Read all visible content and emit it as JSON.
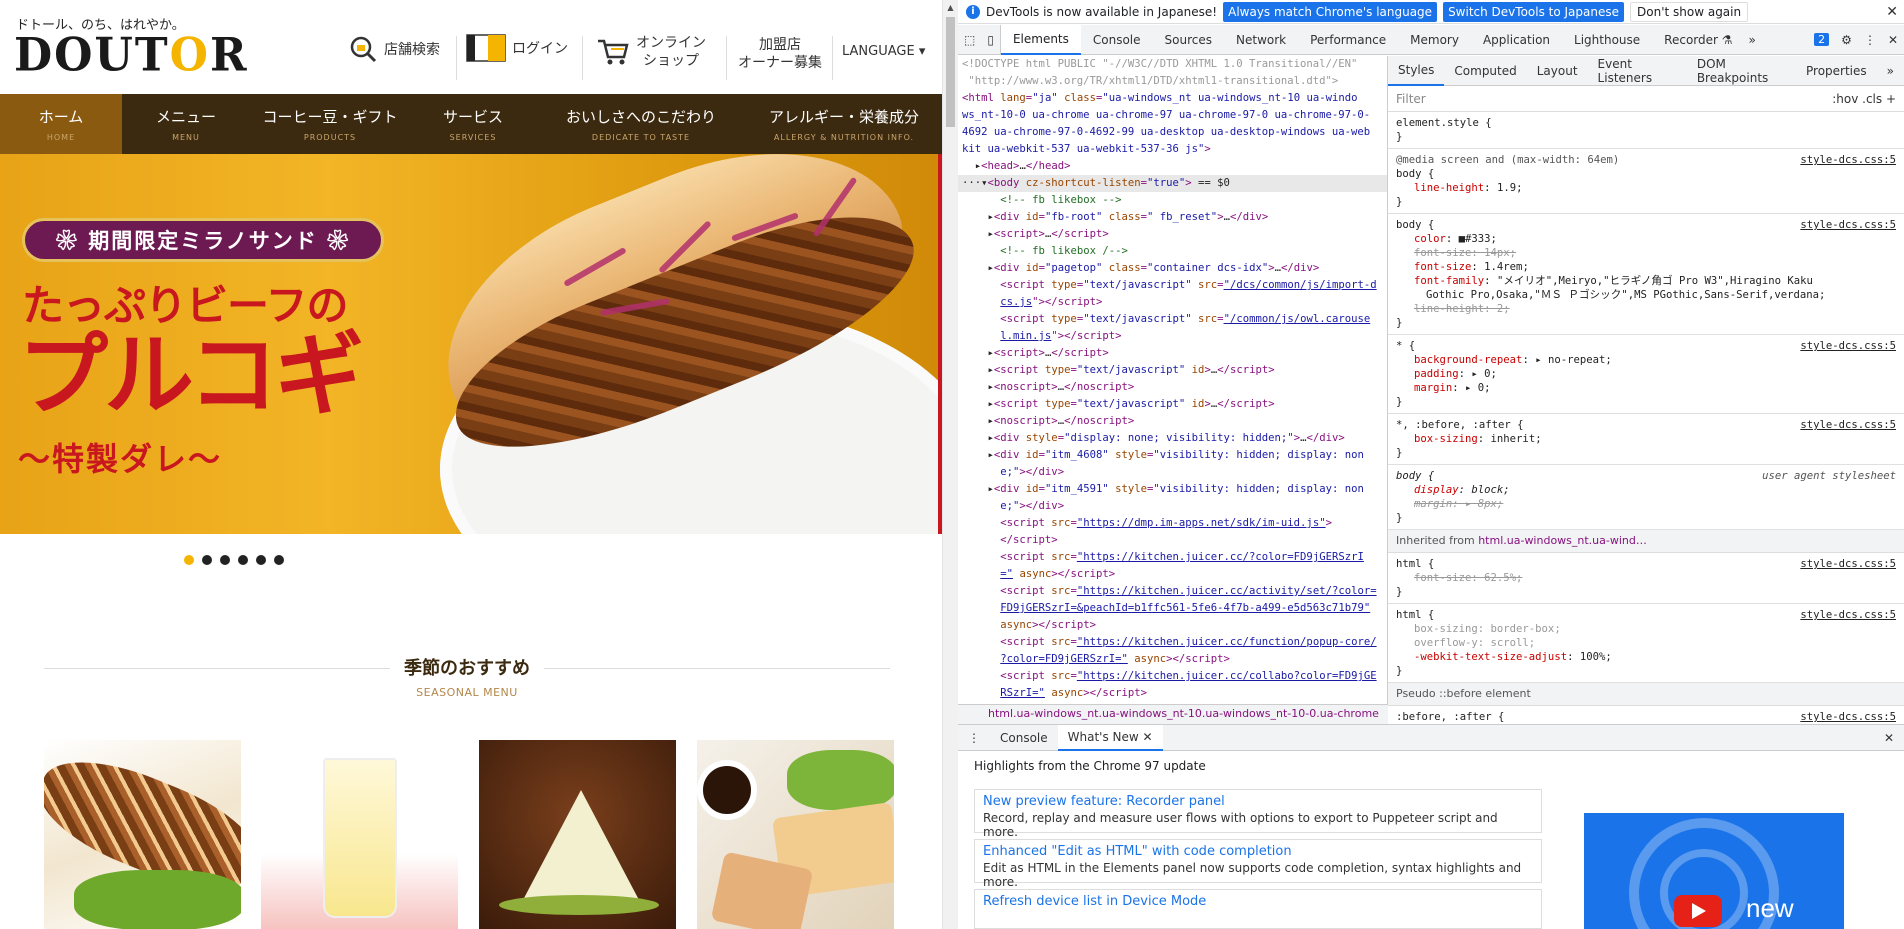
{
  "site": {
    "tagline": "ドトール、のち、はれやか。",
    "logo_text": "DOUTOR",
    "header_links": [
      {
        "label": "店舗検索",
        "icon": "store-search-icon"
      },
      {
        "label": "ログイン",
        "icon": "card-icon"
      },
      {
        "label": "オンライン\nショップ",
        "icon": "cart-icon"
      },
      {
        "label": "加盟店\nオーナー募集",
        "icon": ""
      },
      {
        "label": "LANGUAGE ▾",
        "icon": ""
      }
    ],
    "nav": [
      {
        "jp": "ホーム",
        "en": "HOME",
        "active": true
      },
      {
        "jp": "メニュー",
        "en": "MENU"
      },
      {
        "jp": "コーヒー豆・ギフト",
        "en": "PRODUCTS"
      },
      {
        "jp": "サービス",
        "en": "SERVICES"
      },
      {
        "jp": "おいしさへのこだわり",
        "en": "DEDICATE TO TASTE"
      },
      {
        "jp": "アレルギー・栄養成分",
        "en": "ALLERGY & NUTRITION INFO."
      }
    ],
    "hero": {
      "badge": "❀ 期間限定ミラノサンド ❀",
      "line1": "たっぷりビーフの",
      "line2": "プルコギ",
      "line3": "〜特製ダレ〜"
    },
    "carousel_dots": 6,
    "section": {
      "title": "季節のおすすめ",
      "subtitle": "SEASONAL MENU"
    },
    "colors": {
      "nav_bg": "#3c2a10",
      "nav_active": "#8a5a10",
      "accent": "#f5b400",
      "hero_red": "#c8171e"
    }
  },
  "devtools": {
    "infobar": {
      "message": "DevTools is now available in Japanese!",
      "btn1": "Always match Chrome's language",
      "btn2": "Switch DevTools to Japanese",
      "btn3": "Don't show again"
    },
    "tabs": [
      "Elements",
      "Console",
      "Sources",
      "Network",
      "Performance",
      "Memory",
      "Application",
      "Lighthouse",
      "Recorder ⚗"
    ],
    "issues_badge": "2",
    "style_tabs": [
      "Styles",
      "Computed",
      "Layout",
      "Event Listeners",
      "DOM Breakpoints",
      "Properties"
    ],
    "filter_placeholder": "Filter",
    "filter_opts": ":hov  .cls  +",
    "breadcrumb": "html.ua-windows_nt.ua-windows_nt-10.ua-windows_nt-10-0.ua-chrome",
    "drawer_tabs": [
      "Console",
      "What's New"
    ],
    "whats_new_header": "Highlights from the Chrome 97 update",
    "whats_new": [
      {
        "title": "New preview feature: Recorder panel",
        "desc": "Record, replay and measure user flows with options to export to Puppeteer script and more."
      },
      {
        "title": "Enhanced \"Edit as HTML\" with code completion",
        "desc": "Edit as HTML in the Elements panel now supports code completion, syntax highlights and more."
      },
      {
        "title": "Refresh device list in Device Mode",
        "desc": ""
      }
    ],
    "video_label": "new"
  }
}
